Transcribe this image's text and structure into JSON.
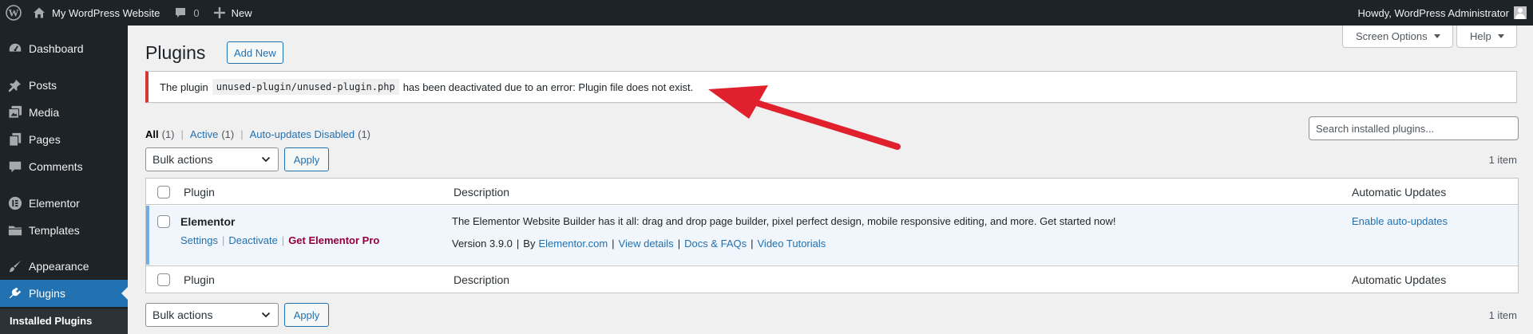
{
  "admin_bar": {
    "site_name": "My WordPress Website",
    "comments_count": "0",
    "new_label": "New",
    "howdy": "Howdy, WordPress Administrator"
  },
  "sidebar": {
    "items": [
      {
        "label": "Dashboard",
        "icon": "dashboard-icon"
      },
      {
        "label": "Posts",
        "icon": "pushpin-icon"
      },
      {
        "label": "Media",
        "icon": "media-icon"
      },
      {
        "label": "Pages",
        "icon": "pages-icon"
      },
      {
        "label": "Comments",
        "icon": "comment-icon"
      },
      {
        "label": "Elementor",
        "icon": "elementor-icon"
      },
      {
        "label": "Templates",
        "icon": "folder-icon"
      },
      {
        "label": "Appearance",
        "icon": "paintbrush-icon"
      },
      {
        "label": "Plugins",
        "icon": "plugin-icon",
        "current": true
      }
    ],
    "submenu": [
      "Installed Plugins"
    ]
  },
  "screen_options": "Screen Options",
  "help": "Help",
  "page": {
    "title": "Plugins",
    "add_new": "Add New"
  },
  "notice": {
    "before": "The plugin",
    "code": "unused-plugin/unused-plugin.php",
    "after": "has been deactivated due to an error: Plugin file does not exist."
  },
  "filters": {
    "all": "All",
    "all_count": "(1)",
    "active": "Active",
    "active_count": "(1)",
    "auto_disabled": "Auto-updates Disabled",
    "auto_disabled_count": "(1)",
    "sep": "|"
  },
  "search": {
    "placeholder": "Search installed plugins..."
  },
  "bulk": {
    "select_label": "Bulk actions",
    "apply": "Apply",
    "item_count": "1 item"
  },
  "table": {
    "columns": [
      "Plugin",
      "Description",
      "Automatic Updates"
    ],
    "rows": [
      {
        "name": "Elementor",
        "actions": [
          "Settings",
          "Deactivate",
          "Get Elementor Pro"
        ],
        "description": "The Elementor Website Builder has it all: drag and drop page builder, pixel perfect design, mobile responsive editing, and more. Get started now!",
        "version": "Version 3.9.0",
        "by": "By",
        "author": "Elementor.com",
        "links": [
          "View details",
          "Docs & FAQs",
          "Video Tutorials"
        ],
        "auto_updates": "Enable auto-updates"
      }
    ]
  },
  "colors": {
    "admin_bar_bg": "#1d2327",
    "accent": "#2271b1",
    "error": "#d63638",
    "arrow": "#e1202e",
    "pro": "#92003b"
  }
}
